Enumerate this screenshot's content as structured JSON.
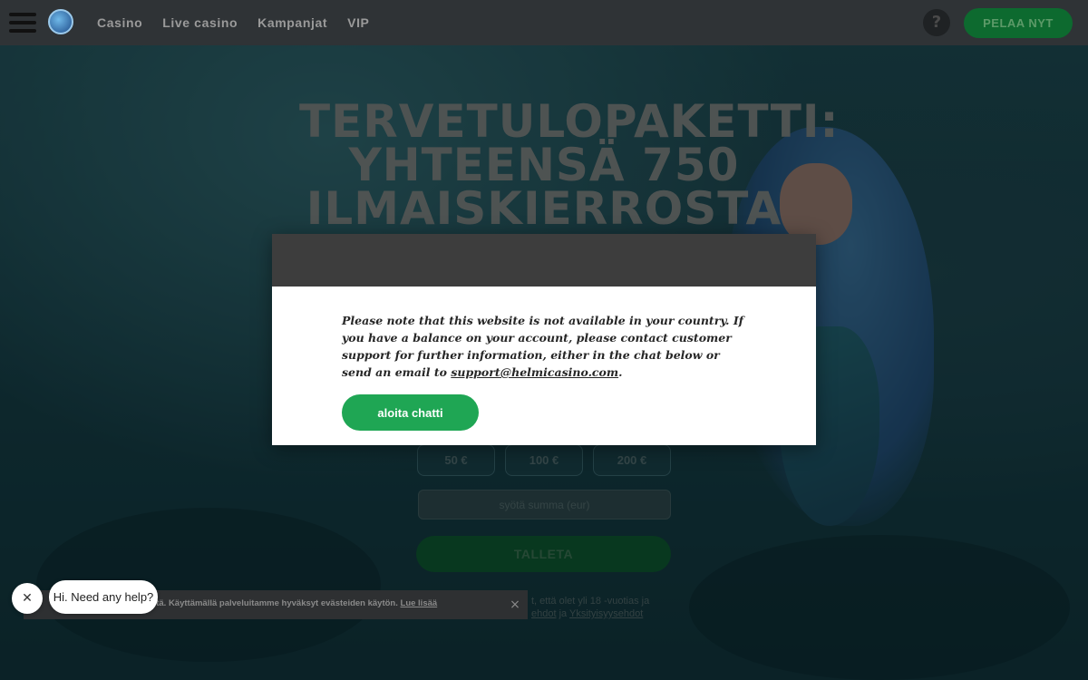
{
  "nav": {
    "items": [
      "Casino",
      "Live casino",
      "Kampanjat",
      "VIP"
    ],
    "play_label": "PELAA NYT",
    "chat_icon": "chat-question-icon"
  },
  "hero": {
    "title_lines": [
      "TERVETULOPAKETTI:",
      "YHTEENSÄ 750",
      "ILMAISKIERROSTA"
    ],
    "amounts": [
      "50 €",
      "100 €",
      "200 €"
    ],
    "sum_placeholder": "syötä summa (eur)",
    "deposit_label": "TALLETA",
    "legal_line1": "t, että olet yli 18 -vuotias ja",
    "legal_link1": "ehdot",
    "legal_mid": "ja",
    "legal_link2": "Yksityisyysehdot"
  },
  "modal": {
    "message": "Please note that this website is not available in your country. If you have a balance on your account, please contact customer support for further information, either in the chat below or send an email to",
    "email": "support@helmicasino.com",
    "email_suffix": ".",
    "chat_button": "aloita chatti"
  },
  "cookie": {
    "text": "evästeitä. Käyttämällä palveluitamme hyväksyt evästeiden käytön.",
    "more_link": "Lue lisää",
    "close": "×"
  },
  "help": {
    "close": "✕",
    "message": "Hi. Need any help?"
  }
}
